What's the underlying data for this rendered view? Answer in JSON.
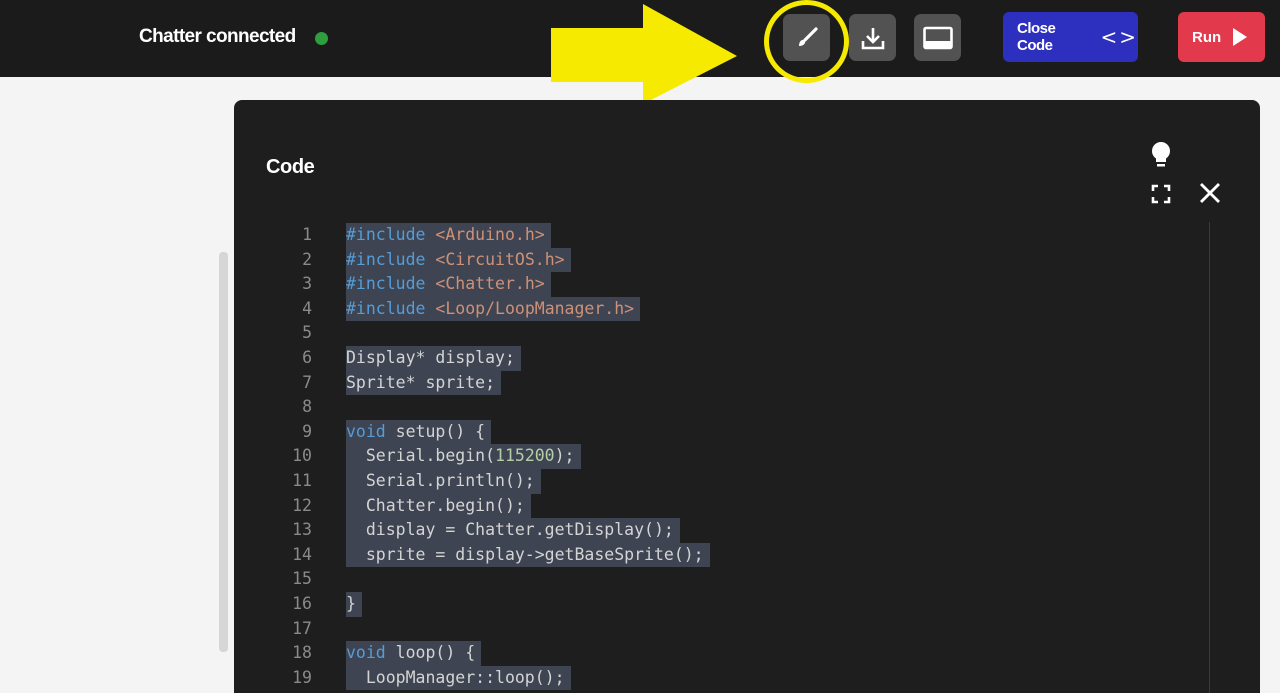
{
  "header": {
    "status_text": "Chatter connected",
    "status_color": "#2f9e3f",
    "tools": [
      {
        "name": "brush-icon",
        "highlighted": true
      },
      {
        "name": "download-icon"
      },
      {
        "name": "terminal-icon"
      }
    ],
    "close_code_label": "Close Code",
    "close_code_icon": "<>",
    "run_label": "Run"
  },
  "panel": {
    "title": "Code",
    "icons": [
      "lightbulb-icon",
      "fullscreen-icon",
      "close-icon"
    ]
  },
  "code": {
    "line_numbers": [
      "1",
      "2",
      "3",
      "4",
      "5",
      "6",
      "7",
      "8",
      "9",
      "10",
      "11",
      "12",
      "13",
      "14",
      "15",
      "16",
      "17",
      "18",
      "19"
    ],
    "lines": [
      "#include <Arduino.h>",
      "#include <CircuitOS.h>",
      "#include <Chatter.h>",
      "#include <Loop/LoopManager.h>",
      "",
      "Display* display;",
      "Sprite* sprite;",
      "",
      "void setup() {",
      "  Serial.begin(115200);",
      "  Serial.println();",
      "  Chatter.begin();",
      "  display = Chatter.getDisplay();",
      "  sprite = display->getBaseSprite();",
      "",
      "}",
      "",
      "void loop() {",
      "  LoopManager::loop();"
    ]
  },
  "colors": {
    "topbar": "#1b1b1b",
    "close_code_button": "#2d2fbf",
    "run_button": "#e23a4c",
    "highlight": "#f5ea00",
    "panel": "#1e1e1e",
    "selection": "#3e4451"
  }
}
